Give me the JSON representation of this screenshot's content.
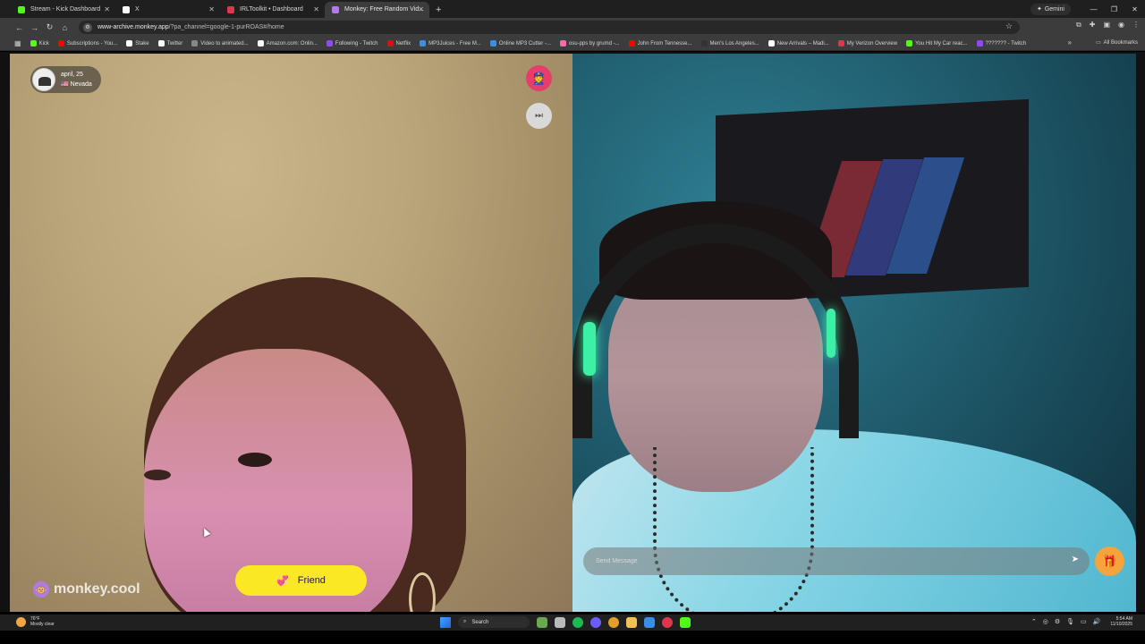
{
  "browser": {
    "tabs": [
      {
        "title": "Stream - Kick Dashboard",
        "icon": "kick-icon",
        "color": "#53fc18",
        "active": false
      },
      {
        "title": "X",
        "icon": "x-icon",
        "color": "#ffffff",
        "active": false
      },
      {
        "title": "IRLToolkit • Dashboard",
        "icon": "irltoolkit-icon",
        "color": "#e0364b",
        "active": false
      },
      {
        "title": "Monkey: Free Random Vid...",
        "icon": "monkey-icon",
        "color": "#b07ae8",
        "active": true
      }
    ],
    "new_tab": "+",
    "gemini_label": "Gemini",
    "url_host": "www-archive.monkey.app",
    "url_path": "/?pa_channel=google-1-purROAS#/home",
    "bookmarks": [
      {
        "label": "Kick",
        "color": "#53fc18"
      },
      {
        "label": "Subscriptions - You...",
        "color": "#ff0000"
      },
      {
        "label": "Stake",
        "color": "#ffffff"
      },
      {
        "label": "Twitter",
        "color": "#ffffff"
      },
      {
        "label": "Video to animated...",
        "color": "#888888"
      },
      {
        "label": "Amazon.com: Onlin...",
        "color": "#ffffff"
      },
      {
        "label": "Following - Twitch",
        "color": "#9146ff"
      },
      {
        "label": "Netflix",
        "color": "#e50914"
      },
      {
        "label": "MP3Juices - Free M...",
        "color": "#3a8ee6"
      },
      {
        "label": "Online MP3 Cutter -...",
        "color": "#3a8ee6"
      },
      {
        "label": "osu-pps by grumd -...",
        "color": "#ff66aa"
      },
      {
        "label": "John From Tennesse...",
        "color": "#ff0000"
      },
      {
        "label": "Men's Los Angeles...",
        "color": "#333333"
      },
      {
        "label": "New Arrivals – Madi...",
        "color": "#ffffff"
      },
      {
        "label": "My Verizon Overview",
        "color": "#e0364b"
      },
      {
        "label": "You Hit My Car reac...",
        "color": "#53fc18"
      },
      {
        "label": "??????? - Twitch",
        "color": "#9146ff"
      }
    ],
    "all_bookmarks": "All Bookmarks"
  },
  "app": {
    "user": {
      "name_age": "april, 25",
      "flag": "🇺🇸",
      "location": "Nevada"
    },
    "brand": "monkey.cool",
    "friend_label": "Friend",
    "message_placeholder": "Send Message"
  },
  "taskbar": {
    "temperature": "76°F",
    "weather": "Mostly clear",
    "search_label": "Search",
    "time": "5:54 AM",
    "date": "11/10/2025"
  }
}
